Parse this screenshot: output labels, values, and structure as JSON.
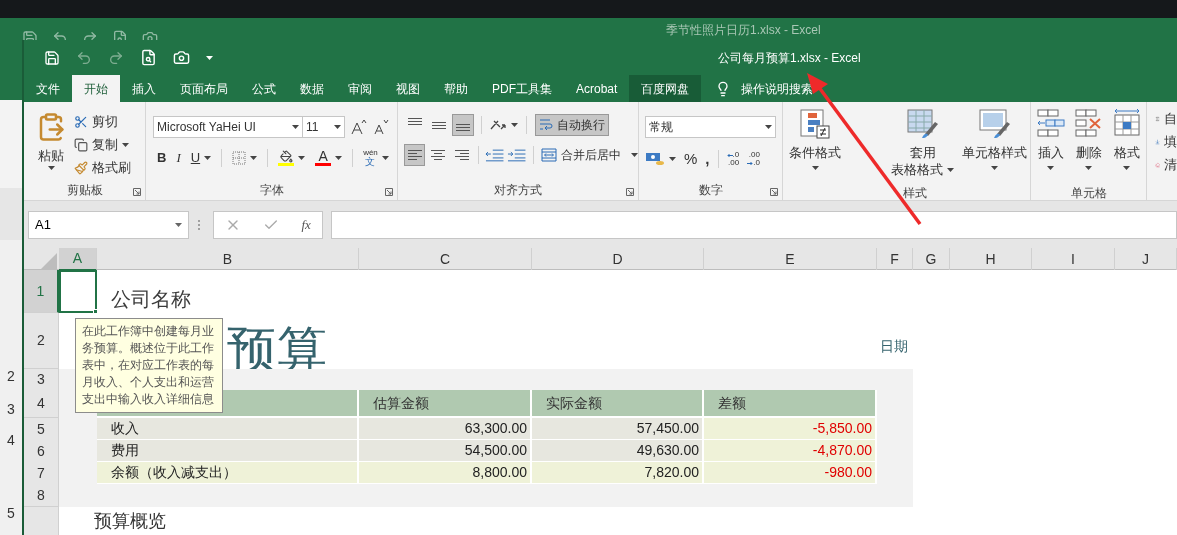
{
  "background_window": {
    "title": "季节性照片日历1.xlsx  -  Excel",
    "row_numbers": [
      "2",
      "3",
      "4",
      "5"
    ]
  },
  "window": {
    "title": "公司每月预算1.xlsx  -  Excel"
  },
  "tabs": [
    {
      "label": "文件",
      "selected": false,
      "highlighted": false
    },
    {
      "label": "开始",
      "selected": true,
      "highlighted": false
    },
    {
      "label": "插入",
      "selected": false,
      "highlighted": false
    },
    {
      "label": "页面布局",
      "selected": false,
      "highlighted": false
    },
    {
      "label": "公式",
      "selected": false,
      "highlighted": false
    },
    {
      "label": "数据",
      "selected": false,
      "highlighted": false
    },
    {
      "label": "审阅",
      "selected": false,
      "highlighted": false
    },
    {
      "label": "视图",
      "selected": false,
      "highlighted": false
    },
    {
      "label": "帮助",
      "selected": false,
      "highlighted": false
    },
    {
      "label": "PDF工具集",
      "selected": false,
      "highlighted": false
    },
    {
      "label": "Acrobat",
      "selected": false,
      "highlighted": false
    },
    {
      "label": "百度网盘",
      "selected": false,
      "highlighted": true
    }
  ],
  "search": {
    "label": "操作说明搜索"
  },
  "ribbon": {
    "clipboard": {
      "group": "剪贴板",
      "paste": "粘贴",
      "cut": "剪切",
      "copy": "复制",
      "painter": "格式刷"
    },
    "font": {
      "group": "字体",
      "family": "Microsoft YaHei UI",
      "size": "11",
      "bold": "B",
      "italic": "I",
      "underline": "U",
      "font_color_glyph": "A",
      "phonetic": [
        "wén",
        "文"
      ]
    },
    "alignment": {
      "group": "对齐方式",
      "vertical": [
        {
          "selected": false
        },
        {
          "selected": false
        },
        {
          "selected": true
        }
      ],
      "horizontal": [
        {
          "selected": true
        },
        {
          "selected": false
        },
        {
          "selected": false
        }
      ],
      "wrap_text": {
        "label": "自动换行",
        "selected": true
      },
      "merge": "合并后居中"
    },
    "number": {
      "group": "数字",
      "format": "常规",
      "percent": "%",
      "comma": ",",
      "increase_decimal": [
        ".0",
        ".00"
      ],
      "decrease_decimal": [
        ".00",
        ".0"
      ]
    },
    "styles": {
      "group": "样式",
      "buttons": [
        {
          "kind": "conditional",
          "lines": [
            "条件格式"
          ]
        },
        {
          "kind": "table",
          "lines": [
            "套用",
            "表格格式"
          ]
        },
        {
          "kind": "cell_style",
          "lines": [
            "单元格样式"
          ]
        }
      ]
    },
    "cells": {
      "group": "单元格",
      "buttons": [
        {
          "kind": "insert",
          "lines": [
            "插入"
          ]
        },
        {
          "kind": "delete",
          "lines": [
            "删除"
          ]
        },
        {
          "kind": "format",
          "lines": [
            "格式"
          ]
        }
      ]
    },
    "editing": {
      "items": [
        {
          "kind": "sum",
          "label": "自"
        },
        {
          "kind": "fill",
          "label": "填"
        },
        {
          "kind": "clear",
          "label": "清"
        }
      ]
    }
  },
  "formula_bar": {
    "name_box": "A1",
    "function_label": "fx"
  },
  "columns": [
    {
      "label": "A",
      "selected": true
    },
    {
      "label": "B",
      "selected": false
    },
    {
      "label": "C",
      "selected": false
    },
    {
      "label": "D",
      "selected": false
    },
    {
      "label": "E",
      "selected": false
    },
    {
      "label": "F",
      "selected": false
    },
    {
      "label": "G",
      "selected": false
    },
    {
      "label": "H",
      "selected": false
    },
    {
      "label": "I",
      "selected": false
    },
    {
      "label": "J",
      "selected": false
    }
  ],
  "rows": [
    {
      "label": "1",
      "selected": true
    },
    {
      "label": "2",
      "selected": false
    },
    {
      "label": "3",
      "selected": false
    },
    {
      "label": "4",
      "selected": false
    },
    {
      "label": "5",
      "selected": false
    },
    {
      "label": "6",
      "selected": false
    },
    {
      "label": "7",
      "selected": false
    },
    {
      "label": "8",
      "selected": false
    }
  ],
  "sheet": {
    "company": "公司名称",
    "title": "预算",
    "date_label": "日期",
    "tooltip": "在此工作簿中创建每月业务预算。概述位于此工作表中，在对应工作表的每月收入、个人支出和运营支出中输入收入详细信息",
    "section_heading": "预算概览",
    "table": {
      "columns": [
        "估算金额",
        "实际金额",
        "差额"
      ],
      "rows": [
        {
          "kind": "item",
          "label": "收入",
          "values": [
            "63,300.00",
            "57,450.00",
            "-5,850.00"
          ]
        },
        {
          "kind": "item",
          "label": "费用",
          "values": [
            "54,500.00",
            "49,630.00",
            "-4,870.00"
          ]
        },
        {
          "kind": "total",
          "label": "余额（收入减支出）",
          "values": [
            "8,800.00",
            "7,820.00",
            "-980.00"
          ]
        }
      ]
    }
  }
}
